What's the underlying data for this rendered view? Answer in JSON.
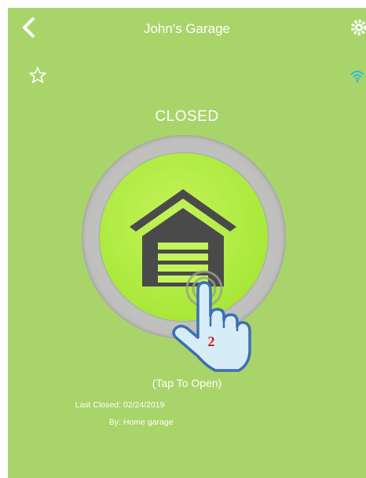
{
  "header": {
    "title": "John's Garage",
    "back_icon": "chevron-left-icon",
    "settings_icon": "gear-icon"
  },
  "favorite_icon": "star-outline-icon",
  "wifi_icon": "wifi-icon",
  "door": {
    "status": "CLOSED",
    "hint": "(Tap To Open)",
    "icon": "garage-door-icon"
  },
  "last_event": {
    "closed_label": "Last Closed:",
    "closed_value": "02/24/2019",
    "by_label": "By:",
    "by_value": "Home garage"
  },
  "overlay": {
    "hand_icon": "tapping-hand-icon",
    "step_number": "2"
  },
  "colors": {
    "background": "#a9d46a",
    "button_inner": "#a9e83a",
    "ring": "#bcbdba",
    "garage": "#4a4a4a",
    "wifi": "#35b6dc",
    "step_number": "#cc1f1f"
  }
}
